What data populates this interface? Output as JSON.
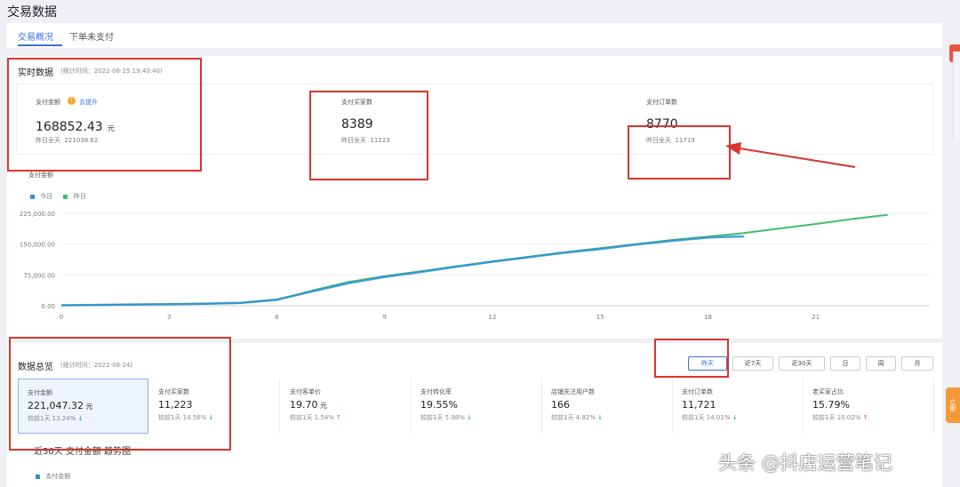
{
  "page_title": "交易数据",
  "tabs": [
    {
      "label": "交易概况",
      "active": true
    },
    {
      "label": "下单未支付",
      "active": false
    }
  ],
  "realtime": {
    "title": "实时数据",
    "stat_time": "(统计时间：2022-08-25 19:40:40)",
    "cards": [
      {
        "label": "支付金额",
        "extra": "去提升",
        "value": "168852.43",
        "unit": "元",
        "yesterday_label": "昨日全天",
        "yesterday_value": "221038.62"
      },
      {
        "label": "支付买家数",
        "value": "8389",
        "yesterday_label": "昨日全天",
        "yesterday_value": "11223"
      },
      {
        "label": "支付订单数",
        "value": "8770",
        "yesterday_label": "昨日全天",
        "yesterday_value": "11719"
      }
    ]
  },
  "chart_data": {
    "type": "line",
    "title": "支付金额",
    "x": [
      0,
      1,
      2,
      3,
      4,
      5,
      6,
      7,
      8,
      9,
      10,
      11,
      12,
      13,
      14,
      15,
      16,
      17,
      18,
      19,
      20,
      21,
      22,
      23
    ],
    "x_ticks": [
      "0",
      "3",
      "6",
      "9",
      "12",
      "15",
      "18",
      "21"
    ],
    "y_ticks": [
      "0.00",
      "75,000.00",
      "150,000.00",
      "225,000.00"
    ],
    "ylim": [
      0,
      225000
    ],
    "xlim": [
      0,
      24
    ],
    "grid": true,
    "legend_position": "top-left",
    "series": [
      {
        "name": "今日",
        "color": "#2f8fd8",
        "values": [
          1000,
          2000,
          3000,
          4000,
          5000,
          7000,
          15000,
          35000,
          55000,
          70000,
          82000,
          95000,
          107000,
          118000,
          129000,
          138000,
          149000,
          158000,
          166000,
          168852
        ]
      },
      {
        "name": "昨日",
        "color": "#3fbf6a",
        "values": [
          800,
          1800,
          2800,
          3800,
          4800,
          6500,
          14000,
          37000,
          58000,
          72000,
          84000,
          96000,
          108000,
          119000,
          130000,
          140000,
          150000,
          160000,
          168000,
          177000,
          188000,
          199000,
          211000,
          221038
        ]
      }
    ]
  },
  "overview": {
    "title": "数据总览",
    "stat_time": "(统计时间：2022-08-24)",
    "range_buttons": [
      "昨天",
      "近7天",
      "近30天",
      "日",
      "周",
      "月"
    ],
    "active_button": "昨天",
    "metrics": [
      {
        "label": "支付金额",
        "value": "221,047.32",
        "unit": "元",
        "cmp": "较前1天 13.24%",
        "dir": "down"
      },
      {
        "label": "支付买家数",
        "value": "11,223",
        "unit": "",
        "cmp": "较前1天 14.56%",
        "dir": "down"
      },
      {
        "label": "支付客单价",
        "value": "19.70",
        "unit": "元",
        "cmp": "较前1天 1.54%",
        "dir": "up"
      },
      {
        "label": "支付转化率",
        "value": "19.55%",
        "unit": "",
        "cmp": "较前1天 5.98%",
        "dir": "down"
      },
      {
        "label": "店铺关注用户数",
        "value": "166",
        "unit": "",
        "cmp": "较前1天 4.82%",
        "dir": "down"
      },
      {
        "label": "支付订单数",
        "value": "11,721",
        "unit": "",
        "cmp": "较前1天 14.01%",
        "dir": "down"
      },
      {
        "label": "老买家占比",
        "value": "15.79%",
        "unit": "",
        "cmp": "较前1天 10.02%",
        "dir": "up"
      }
    ],
    "trend_title": "近30天 支付金额 趋势图",
    "trend_legend": "支付金额"
  },
  "watermark": "头条 @抖店运营笔记",
  "side_badge": "立即"
}
